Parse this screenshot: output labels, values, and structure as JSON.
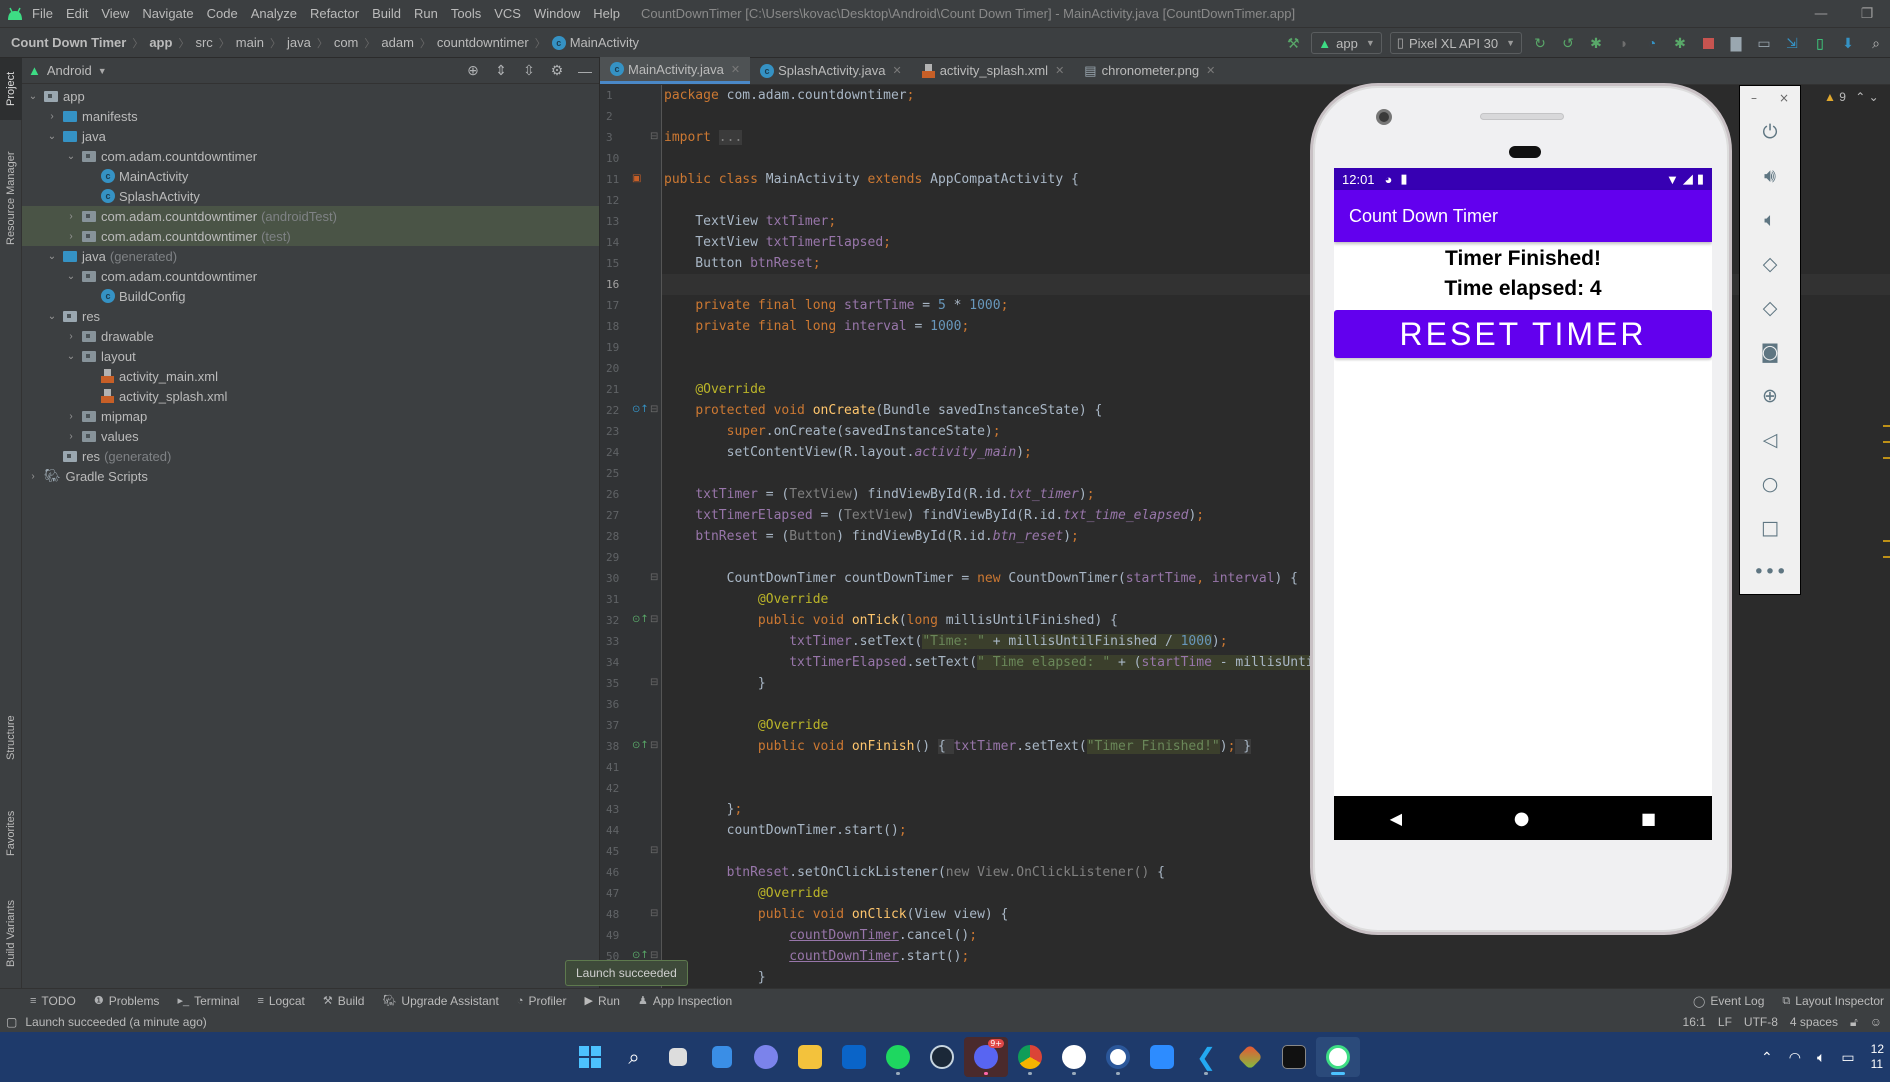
{
  "window": {
    "title": "CountDownTimer [C:\\Users\\kovac\\Desktop\\Android\\Count Down Timer] - MainActivity.java [CountDownTimer.app]",
    "menu": [
      "File",
      "Edit",
      "View",
      "Navigate",
      "Code",
      "Analyze",
      "Refactor",
      "Build",
      "Run",
      "Tools",
      "VCS",
      "Window",
      "Help"
    ]
  },
  "breadcrumb": [
    "Count Down Timer",
    "app",
    "src",
    "main",
    "java",
    "com",
    "adam",
    "countdowntimer",
    "MainActivity"
  ],
  "toolbar": {
    "run_config": "app",
    "device": "Pixel XL API 30",
    "icons": [
      "hammer-icon",
      "apply-changes-icon",
      "apply-code-changes-icon",
      "debug-icon",
      "attach-icon",
      "profile-icon",
      "attach-debugger-icon",
      "stop-icon",
      "device-file-explorer-icon",
      "avd-manager-icon",
      "sync-gradle-icon",
      "device-manager-icon",
      "sdk-manager-icon",
      "search-icon"
    ]
  },
  "left_stripe": [
    "Project",
    "Resource Manager",
    "Structure",
    "Favorites",
    "Build Variants"
  ],
  "project": {
    "view": "Android",
    "tree": [
      {
        "label": "app",
        "depth": 0,
        "expanded": true,
        "icon": "module"
      },
      {
        "label": "manifests",
        "depth": 1,
        "expanded": false,
        "icon": "folder-blue"
      },
      {
        "label": "java",
        "depth": 1,
        "expanded": true,
        "icon": "folder-blue"
      },
      {
        "label": "com.adam.countdowntimer",
        "depth": 2,
        "expanded": true,
        "icon": "package"
      },
      {
        "label": "MainActivity",
        "depth": 3,
        "icon": "class"
      },
      {
        "label": "SplashActivity",
        "depth": 3,
        "icon": "class"
      },
      {
        "label": "com.adam.countdowntimer",
        "suffix": "(androidTest)",
        "depth": 2,
        "expanded": false,
        "icon": "package",
        "hl": true
      },
      {
        "label": "com.adam.countdowntimer",
        "suffix": "(test)",
        "depth": 2,
        "expanded": false,
        "icon": "package",
        "hl": true
      },
      {
        "label": "java",
        "suffix": "(generated)",
        "depth": 1,
        "expanded": true,
        "icon": "folder-gen"
      },
      {
        "label": "com.adam.countdowntimer",
        "depth": 2,
        "expanded": true,
        "icon": "package"
      },
      {
        "label": "BuildConfig",
        "depth": 3,
        "icon": "class"
      },
      {
        "label": "res",
        "depth": 1,
        "expanded": true,
        "icon": "folder-res"
      },
      {
        "label": "drawable",
        "depth": 2,
        "expanded": false,
        "icon": "package"
      },
      {
        "label": "layout",
        "depth": 2,
        "expanded": true,
        "icon": "package"
      },
      {
        "label": "activity_main.xml",
        "depth": 3,
        "icon": "xml"
      },
      {
        "label": "activity_splash.xml",
        "depth": 3,
        "icon": "xml"
      },
      {
        "label": "mipmap",
        "depth": 2,
        "expanded": false,
        "icon": "package"
      },
      {
        "label": "values",
        "depth": 2,
        "expanded": false,
        "icon": "package"
      },
      {
        "label": "res",
        "suffix": "(generated)",
        "depth": 1,
        "icon": "folder-res"
      },
      {
        "label": "Gradle Scripts",
        "depth": 0,
        "expanded": false,
        "icon": "gradle"
      }
    ]
  },
  "tabs": [
    {
      "label": "MainActivity.java",
      "icon": "class",
      "active": true
    },
    {
      "label": "SplashActivity.java",
      "icon": "class"
    },
    {
      "label": "activity_splash.xml",
      "icon": "xml"
    },
    {
      "label": "chronometer.png",
      "icon": "image"
    }
  ],
  "editor": {
    "current_line": "16",
    "lines": [
      {
        "n": "1",
        "html": "<span class='kw'>package</span> com.adam.countdowntimer<span class='kw'>;</span>"
      },
      {
        "n": "2",
        "html": ""
      },
      {
        "n": "3",
        "html": "<span class='kw'>import</span> <span class='gray' style='background:#3b3b3b'>...</span>"
      },
      {
        "n": "10",
        "html": ""
      },
      {
        "n": "11",
        "html": "<span class='kw'>public class</span> MainActivity <span class='kw'>extends</span> AppCompatActivity {"
      },
      {
        "n": "12",
        "html": ""
      },
      {
        "n": "13",
        "html": "    TextView <span class='fld'>txtTimer</span><span class='kw'>;</span>"
      },
      {
        "n": "14",
        "html": "    TextView <span class='fld'>txtTimerElapsed</span><span class='kw'>;</span>"
      },
      {
        "n": "15",
        "html": "    Button <span class='fld'>btnReset</span><span class='kw'>;</span>"
      },
      {
        "n": "16",
        "html": ""
      },
      {
        "n": "17",
        "html": "    <span class='kw'>private final long</span> <span class='fld'>startTime</span> = <span class='num'>5</span> * <span class='num'>1000</span><span class='kw'>;</span>"
      },
      {
        "n": "18",
        "html": "    <span class='kw'>private final long</span> <span class='fld'>interval</span> = <span class='num'>1000</span><span class='kw'>;</span>"
      },
      {
        "n": "19",
        "html": ""
      },
      {
        "n": "20",
        "html": ""
      },
      {
        "n": "21",
        "html": "    <span class='an'>@Override</span>"
      },
      {
        "n": "22",
        "html": "    <span class='kw'>protected void</span> <span class='fn'>onCreate</span>(Bundle savedInstanceState) {"
      },
      {
        "n": "23",
        "html": "        <span class='kw'>super</span>.onCreate(savedInstanceState)<span class='kw'>;</span>"
      },
      {
        "n": "24",
        "html": "        setContentView(R.layout.<span class='fldi'>activity_main</span>)<span class='kw'>;</span>"
      },
      {
        "n": "25",
        "html": ""
      },
      {
        "n": "26",
        "html": "    <span class='fld'>txtTimer</span> = (<span class='gray'>TextView</span>) findViewById(R.id.<span class='fldi'>txt_timer</span>)<span class='kw'>;</span>"
      },
      {
        "n": "27",
        "html": "    <span class='fld'>txtTimerElapsed</span> = (<span class='gray'>TextView</span>) findViewById(R.id.<span class='fldi'>txt_time_elapsed</span>)<span class='kw'>;</span>"
      },
      {
        "n": "28",
        "html": "    <span class='fld'>btnReset</span> = (<span class='gray'>Button</span>) findViewById(R.id.<span class='fldi'>btn_reset</span>)<span class='kw'>;</span>"
      },
      {
        "n": "29",
        "html": ""
      },
      {
        "n": "30",
        "html": "        CountDownTimer countDownTimer = <span class='kw'>new</span> CountDownTimer(<span class='fld'>startTime</span><span class='kw'>,</span> <span class='fld'>interval</span>) {"
      },
      {
        "n": "31",
        "html": "            <span class='an'>@Override</span>"
      },
      {
        "n": "32",
        "html": "            <span class='kw'>public void</span> <span class='fn'>onTick</span>(<span class='kw'>long</span> millisUntilFinished) {"
      },
      {
        "n": "33",
        "html": "                <span class='fld'>txtTimer</span>.setText(<span class='strbg'>\"Time: \" <span style='color:#a9b7c6'>+ millisUntilFinished / </span><span class='num'>1000</span></span>)<span class='kw'>;</span>"
      },
      {
        "n": "34",
        "html": "                <span class='fld'>txtTimerElapsed</span>.setText(<span class='strbg'>\" Time elapsed: \" <span style='color:#a9b7c6'>+ (</span><span class='fld'>startTime</span><span style='color:#a9b7c6'> - millisUntilFinished</span></span>"
      },
      {
        "n": "35",
        "html": "            }"
      },
      {
        "n": "36",
        "html": ""
      },
      {
        "n": "37",
        "html": "            <span class='an'>@Override</span>"
      },
      {
        "n": "38",
        "html": "            <span class='kw'>public void</span> <span class='fn'>onFinish</span>() <span style='background:#3b3b3b'>{ </span><span class='fld'>txtTimer</span>.setText(<span class='strbg'>\"Timer Finished!\"</span>)<span class='kw'>;</span><span style='background:#3b3b3b'> }</span>"
      },
      {
        "n": "41",
        "html": ""
      },
      {
        "n": "42",
        "html": ""
      },
      {
        "n": "43",
        "html": "        }<span class='kw'>;</span>"
      },
      {
        "n": "44",
        "html": "        countDownTimer.start()<span class='kw'>;</span>"
      },
      {
        "n": "45",
        "html": ""
      },
      {
        "n": "46",
        "html": "        <span class='fld'>btnReset</span>.setOnClickListener(<span class='gray'>new View.OnClickListener()</span> {"
      },
      {
        "n": "47",
        "html": "            <span class='an'>@Override</span>"
      },
      {
        "n": "48",
        "html": "            <span class='kw'>public void</span> <span class='fn'>onClick</span>(View view) {"
      },
      {
        "n": "49",
        "html": "                <span class='ul'>countDownTimer</span>.cancel()<span class='kw'>;</span>"
      },
      {
        "n": "50",
        "html": "                <span class='ul'>countDownTimer</span>.start()<span class='kw'>;</span>"
      },
      {
        "n": "",
        "html": "            }"
      }
    ]
  },
  "inspections": {
    "warnings": "9"
  },
  "emulator": {
    "status_time": "12:01",
    "app_title": "Count Down Timer",
    "timer_text": "Timer Finished!",
    "elapsed_text": "Time elapsed: 4",
    "reset_button": "RESET TIMER",
    "controls": [
      "power-icon",
      "volume-up-icon",
      "volume-down-icon",
      "rotate-left-icon",
      "rotate-right-icon",
      "camera-icon",
      "zoom-icon",
      "back-icon",
      "home-icon",
      "overview-icon",
      "more-icon"
    ],
    "primary_color": "#6200ee",
    "status_color": "#3700b3"
  },
  "tool_windows": {
    "left": [
      "TODO",
      "Problems",
      "Terminal",
      "Logcat",
      "Build",
      "Upgrade Assistant",
      "Profiler",
      "Run",
      "App Inspection"
    ],
    "right": [
      "Event Log",
      "Layout Inspector"
    ]
  },
  "tooltip": "Launch succeeded",
  "status": {
    "message": "Launch succeeded (a minute ago)",
    "position": "16:1",
    "line_sep": "LF",
    "encoding": "UTF-8",
    "indent": "4 spaces"
  },
  "taskbar": {
    "apps": [
      "windows-start",
      "search",
      "task-view",
      "widgets",
      "teams-chat",
      "file-explorer",
      "outlook",
      "spotify",
      "steam",
      "discord",
      "chrome",
      "slack",
      "word",
      "zoom",
      "vscode",
      "git",
      "terminal",
      "android-studio"
    ],
    "discord_badge": "9+",
    "clock_partial": "12",
    "date_partial": "11"
  }
}
